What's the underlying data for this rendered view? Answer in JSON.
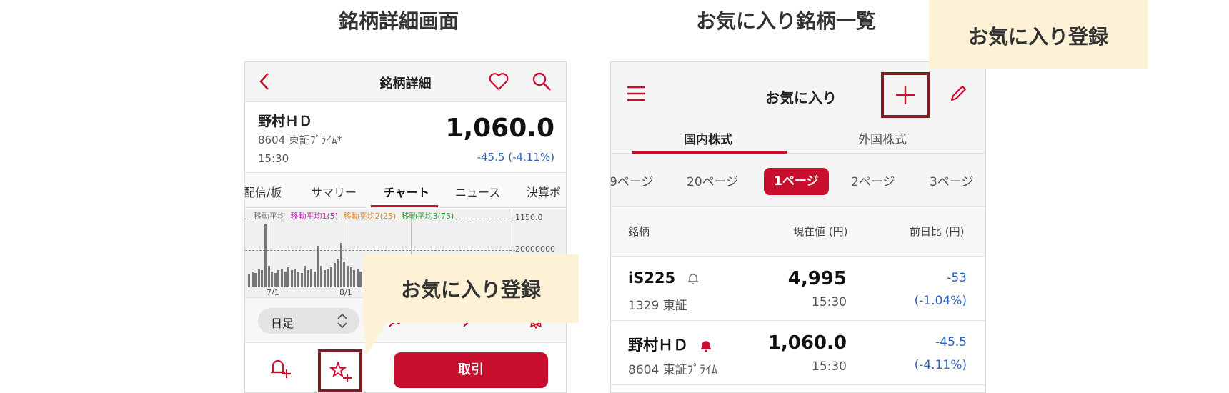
{
  "titles": {
    "left": "銘柄詳細画面",
    "right": "お気に入り銘柄一覧"
  },
  "callouts": {
    "detail": "お気に入り登録",
    "list": "お気に入り登録"
  },
  "detail_screen": {
    "header_title": "銘柄詳細",
    "stock": {
      "name": "野村ＨＤ",
      "meta": "8604  東証ﾌﾟﾗｲﾑ*",
      "time": "15:30",
      "price": "1,060.0",
      "change": "-45.5 (-4.11%)"
    },
    "tabs": [
      "配信/板",
      "サマリー",
      "チャート",
      "ニュース",
      "決算ポ"
    ],
    "active_tab": "チャート",
    "chart": {
      "legend": [
        "移動平均",
        "移動平均1(5)",
        "移動平均2(25)",
        "移動平均3(75)"
      ],
      "axis_labels": [
        "1150.0",
        "20000000"
      ],
      "dates": [
        "7/1",
        "8/1"
      ]
    },
    "period": "日足",
    "trade_button": "取引",
    "colors": {
      "accent": "#c8102e",
      "negative": "#2e62b8",
      "ma1": "#c21fb4",
      "ma2": "#e8892b",
      "ma3": "#2a9b3c"
    }
  },
  "favorites_screen": {
    "header_title": "お気に入り",
    "tabs": [
      "国内株式",
      "外国株式"
    ],
    "pages": [
      "9ページ",
      "20ページ",
      "1ページ",
      "2ページ",
      "3ページ"
    ],
    "active_page": "1ページ",
    "columns": [
      "銘柄",
      "現在値 (円)",
      "前日比 (円)"
    ],
    "rows": [
      {
        "name": "iS225",
        "code": "1329  東証",
        "price": "4,995",
        "time": "15:30",
        "change": "-53",
        "pct": "(-1.04%)",
        "alert": "bell-outline"
      },
      {
        "name": "野村ＨＤ",
        "code": "8604  東証ﾌﾟﾗｲﾑ",
        "price": "1,060.0",
        "time": "15:30",
        "change": "-45.5",
        "pct": "(-4.11%)",
        "alert": "bell-filled"
      }
    ]
  }
}
